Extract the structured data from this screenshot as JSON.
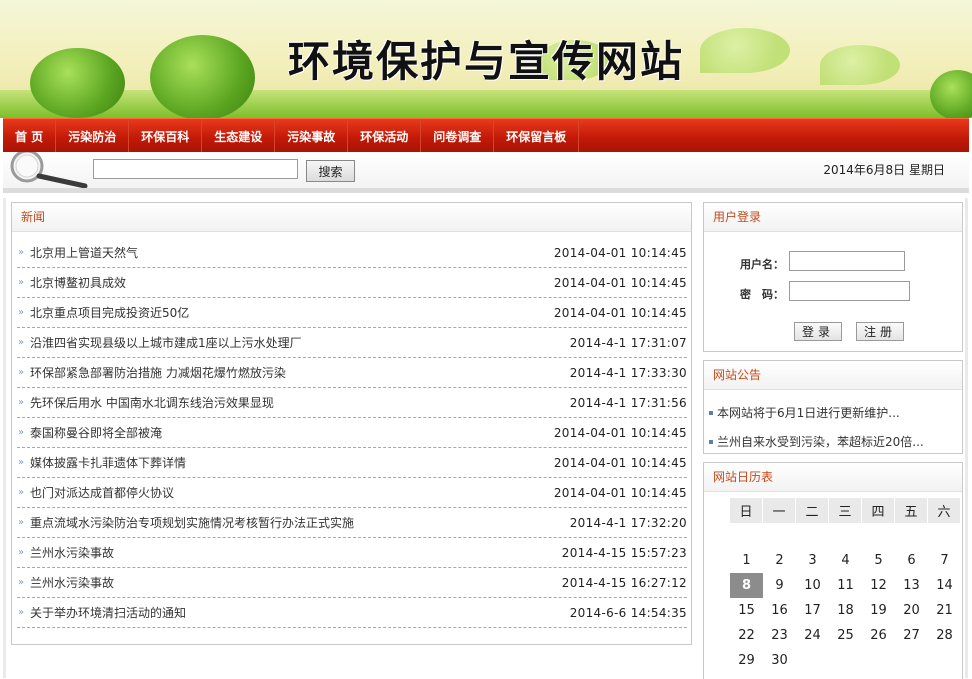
{
  "banner": {
    "title": "环境保护与宣传网站"
  },
  "nav": {
    "items": [
      "首 页",
      "污染防治",
      "环保百科",
      "生态建设",
      "污染事故",
      "环保活动",
      "问卷调查",
      "环保留言板"
    ]
  },
  "search": {
    "value": "",
    "button": "搜索"
  },
  "date": "2014年6月8日 星期日",
  "news": {
    "heading": "新闻",
    "items": [
      {
        "title": "北京用上管道天然气",
        "date": "2014-04-01 10:14:45"
      },
      {
        "title": "北京博鳌初具成效",
        "date": "2014-04-01 10:14:45"
      },
      {
        "title": "北京重点项目完成投资近50亿",
        "date": "2014-04-01 10:14:45"
      },
      {
        "title": "沿淮四省实现县级以上城市建成1座以上污水处理厂",
        "date": "2014-4-1 17:31:07"
      },
      {
        "title": "环保部紧急部署防治措施 力减烟花爆竹燃放污染",
        "date": "2014-4-1 17:33:30"
      },
      {
        "title": "先环保后用水 中国南水北调东线治污效果显现",
        "date": "2014-4-1 17:31:56"
      },
      {
        "title": "泰国称曼谷即将全部被淹",
        "date": "2014-04-01 10:14:45"
      },
      {
        "title": "媒体披露卡扎菲遗体下葬详情",
        "date": "2014-04-01 10:14:45"
      },
      {
        "title": "也门对派达成首都停火协议",
        "date": "2014-04-01 10:14:45"
      },
      {
        "title": "重点流域水污染防治专项规划实施情况考核暂行办法正式实施",
        "date": "2014-4-1 17:32:20"
      },
      {
        "title": "兰州水污染事故",
        "date": "2014-4-15 15:57:23"
      },
      {
        "title": "兰州水污染事故",
        "date": "2014-4-15 16:27:12"
      },
      {
        "title": "关于举办环境清扫活动的通知",
        "date": "2014-6-6 14:54:35"
      }
    ]
  },
  "login": {
    "heading": "用户登录",
    "username_label": "用户名：",
    "password_label": "密　码：",
    "username_value": "",
    "password_value": "",
    "login_button": "登录",
    "register_button": "注册"
  },
  "notice": {
    "heading": "网站公告",
    "items": [
      "本网站将于6月1日进行更新维护...",
      "兰州自来水受到污染，苯超标近20倍..."
    ]
  },
  "calendar": {
    "heading": "网站日历表",
    "weekdays": [
      "日",
      "一",
      "二",
      "三",
      "四",
      "五",
      "六"
    ],
    "weeks": [
      [
        "",
        "",
        "",
        "",
        "",
        "",
        ""
      ],
      [
        "1",
        "2",
        "3",
        "4",
        "5",
        "6",
        "7"
      ],
      [
        "8",
        "9",
        "10",
        "11",
        "12",
        "13",
        "14"
      ],
      [
        "15",
        "16",
        "17",
        "18",
        "19",
        "20",
        "21"
      ],
      [
        "22",
        "23",
        "24",
        "25",
        "26",
        "27",
        "28"
      ],
      [
        "29",
        "30",
        "",
        "",
        "",
        "",
        ""
      ]
    ],
    "today": "8"
  },
  "colors": {
    "nav_red": "#c31a08",
    "heading_orange": "#c34a1a",
    "today_gray": "#8c8c8c"
  },
  "icons": {
    "search": "magnifier-icon",
    "bullet": "double-arrow-icon",
    "notice_bullet": "square-icon"
  }
}
